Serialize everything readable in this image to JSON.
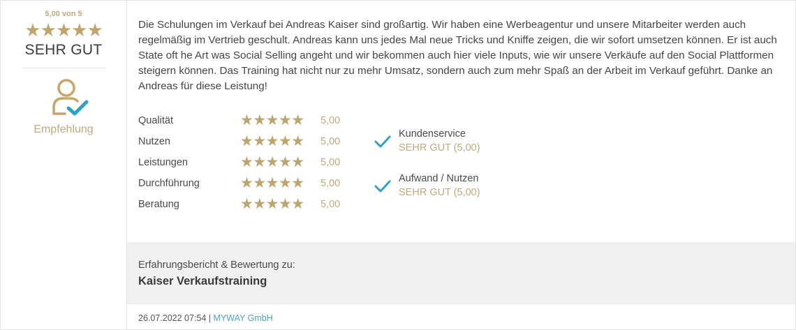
{
  "summary": {
    "score_label": "5,00 von 5",
    "stars": "★★★★★",
    "verdict": "SEHR GUT",
    "recommend_icon": "user-check-icon",
    "recommend_label": "Empfehlung"
  },
  "review": {
    "text": "Die Schulungen im Verkauf bei Andreas Kaiser sind großartig. Wir haben eine Werbeagentur und unsere Mitarbeiter werden auch regelmäßig im Vertrieb geschult. Andreas kann uns jedes Mal neue Tricks und Kniffe zeigen, die wir sofort umsetzen können. Er ist auch State oft he Art was Social Selling angeht und wir bekommen auch hier viele Inputs, wie wir unsere Verkäufe auf den Social Plattformen steigern können. Das Training hat nicht nur zu mehr Umsatz, sondern auch zum mehr Spaß an der Arbeit im Verkauf geführt. Danke an Andreas für diese Leistung!"
  },
  "ratings": [
    {
      "name": "Qualität",
      "stars": "★★★★★",
      "value": "5,00"
    },
    {
      "name": "Nutzen",
      "stars": "★★★★★",
      "value": "5,00"
    },
    {
      "name": "Leistungen",
      "stars": "★★★★★",
      "value": "5,00"
    },
    {
      "name": "Durchführung",
      "stars": "★★★★★",
      "value": "5,00"
    },
    {
      "name": "Beratung",
      "stars": "★★★★★",
      "value": "5,00"
    }
  ],
  "badges": [
    {
      "title": "Kundenservice",
      "value": "SEHR GUT (5,00)",
      "icon": "checkmark-icon"
    },
    {
      "title": "Aufwand / Nutzen",
      "value": "SEHR GUT (5,00)",
      "icon": "checkmark-icon"
    }
  ],
  "footer": {
    "caption": "Erfahrungsbericht & Bewertung zu:",
    "product": "Kaiser Verkaufstraining"
  },
  "meta": {
    "datetime": "26.07.2022 07:54",
    "separator": " | ",
    "author": "MYWAY GmbH"
  },
  "colors": {
    "gold": "#bea46d",
    "accent_blue": "#2aa3c4",
    "panel_gray": "#f0f0f0"
  }
}
